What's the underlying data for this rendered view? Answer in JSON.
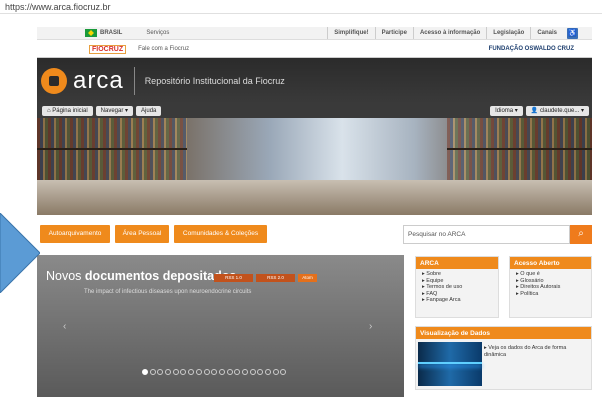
{
  "browser": {
    "url": "https://www.arca.fiocruz.br"
  },
  "gov_bar": {
    "brasil": "BRASIL",
    "servicos": "Serviços",
    "links": [
      "Simplifique!",
      "Participe",
      "Acesso à informação",
      "Legislação",
      "Canais"
    ]
  },
  "fiocruz_bar": {
    "logo": "FIOCRUZ",
    "fale": "Fale com a Fiocruz",
    "fundacao": "FUNDAÇÃO OSWALDO CRUZ"
  },
  "header": {
    "logo_text": "arca",
    "title": "Repositório Institucional da Fiocruz"
  },
  "nav": {
    "home": "Página inicial",
    "navegar": "Navegar ▾",
    "ajuda": "Ajuda",
    "idioma": "Idioma ▾",
    "user": "claudete.que... ▾"
  },
  "actions": {
    "autoarquivamento": "Autoarquivamento",
    "area_pessoal": "Área Pessoal",
    "comunidades": "Comunidades & Coleções"
  },
  "search": {
    "placeholder": "Pesquisar no ARCA",
    "icon": "search-icon"
  },
  "slider": {
    "title_light": "Novos",
    "title_bold": "documentos depositados",
    "feeds": [
      "RSS 1.0",
      "RSS 2.0",
      "Atom"
    ],
    "headline": "The impact of infectious diseases upon neuroendocrine circuits",
    "dots_total": 19,
    "active_dot": 0
  },
  "arca_panel": {
    "title": "ARCA",
    "items": [
      "Sobre",
      "Equipe",
      "Termos de uso",
      "FAQ",
      "Fanpage Arca"
    ]
  },
  "acesso_panel": {
    "title": "Acesso Aberto",
    "items": [
      "O que é",
      "Glossário",
      "Direitos Autorais",
      "Política"
    ]
  },
  "viz_panel": {
    "title": "Visualização de Dados",
    "text": "Veja os dados do Arca de forma dinâmica"
  },
  "colors": {
    "accent": "#ef8a1c",
    "header_bg": "#2b2b2b"
  }
}
